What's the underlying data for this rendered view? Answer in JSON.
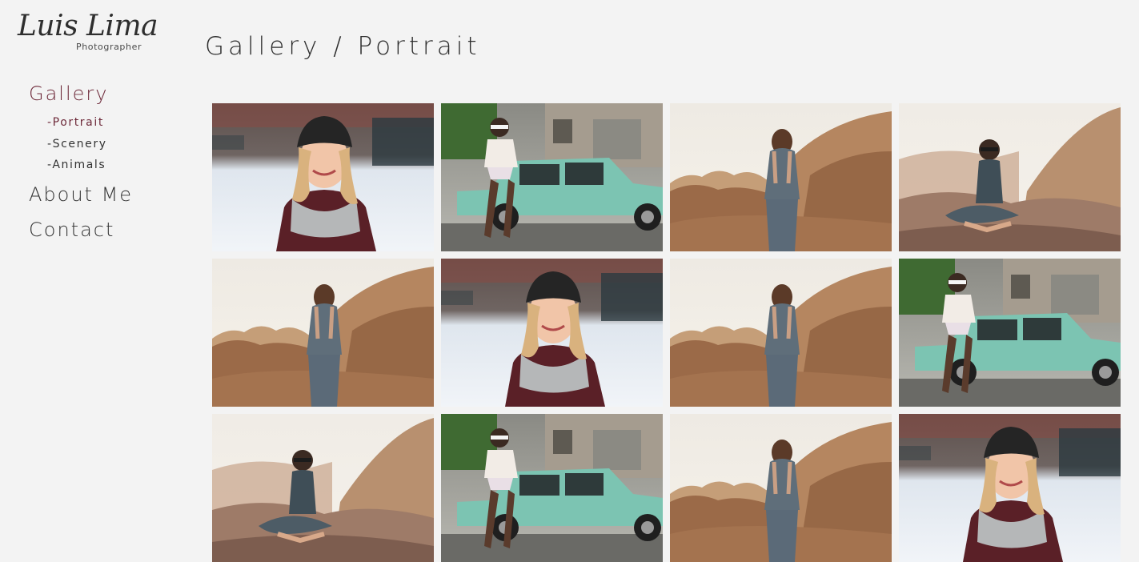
{
  "brand": {
    "name": "Luis Lima",
    "tagline": "Photographer"
  },
  "nav": {
    "gallery": "Gallery",
    "sub": [
      {
        "label": "-Portrait"
      },
      {
        "label": "-Scenery"
      },
      {
        "label": "-Animals"
      }
    ],
    "about": "About Me",
    "contact": "Contact"
  },
  "header": {
    "title": "Gallery / Portrait"
  },
  "colors": {
    "accent": "#6e2a3a",
    "background": "#f3f3f3",
    "text": "#2e2e2e"
  },
  "gallery": {
    "photos": [
      {
        "subject": "woman-beanie-snow"
      },
      {
        "subject": "woman-green-car"
      },
      {
        "subject": "woman-desert-back"
      },
      {
        "subject": "woman-desert-sitting"
      },
      {
        "subject": "woman-desert-back"
      },
      {
        "subject": "woman-beanie-snow"
      },
      {
        "subject": "woman-desert-back"
      },
      {
        "subject": "woman-green-car"
      },
      {
        "subject": "woman-desert-sitting"
      },
      {
        "subject": "woman-green-car"
      },
      {
        "subject": "woman-desert-back"
      },
      {
        "subject": "woman-beanie-snow"
      }
    ]
  }
}
